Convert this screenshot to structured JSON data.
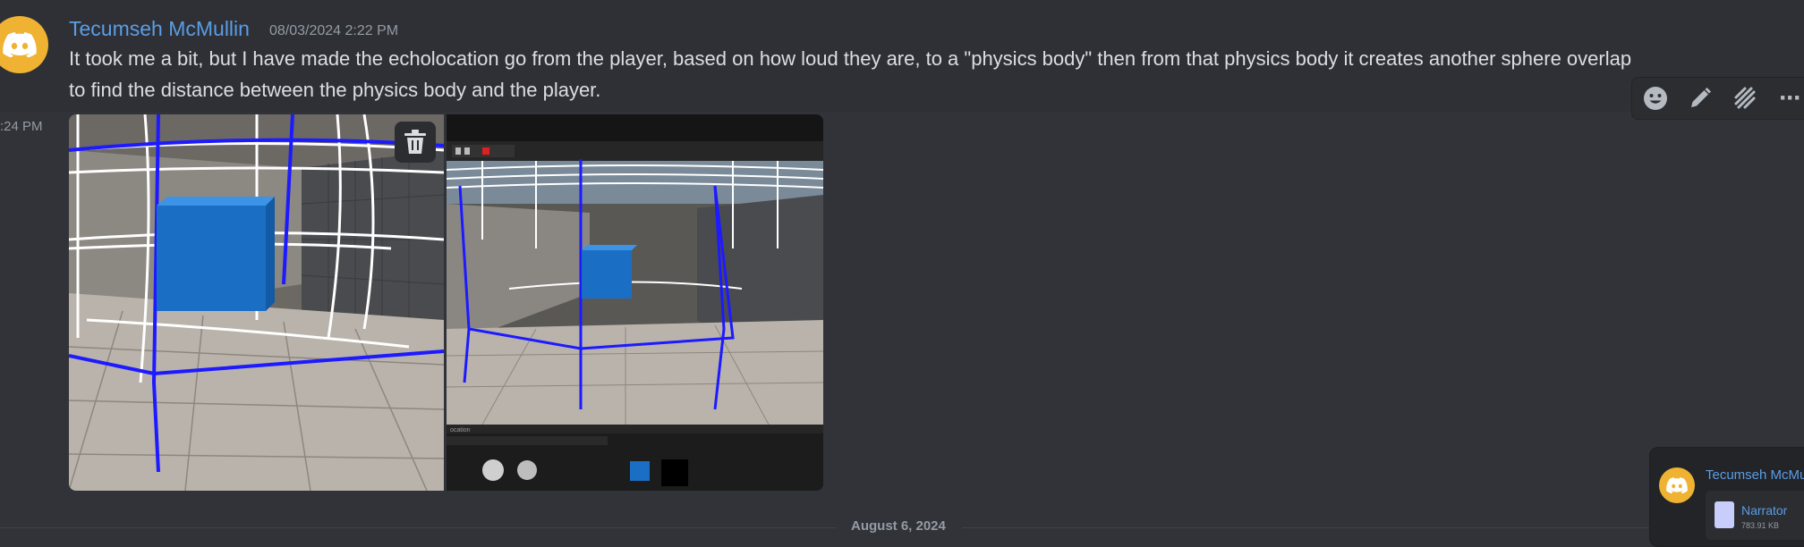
{
  "message": {
    "author": "Tecumseh McMullin",
    "timestamp": "08/03/2024 2:22 PM",
    "content_line1": "It took me a bit, but I have made the echolocation go from the player, based on how loud they are, to a \"physics body\" then from that physics body it creates another sphere overlap",
    "content_line2": "to find the distance between the physics body and the player."
  },
  "next_message": {
    "side_time": ":24 PM"
  },
  "toolbar": {
    "icons": [
      "emoji-icon",
      "pencil-icon",
      "thread-icon",
      "more-icon"
    ],
    "more_label": "···"
  },
  "attachments": {
    "trash_icon": "trash-icon",
    "image2_label": "ocation"
  },
  "divider": {
    "date": "August 6, 2024"
  },
  "popup": {
    "author": "Tecumseh McMullin",
    "file_name": "Narrator",
    "file_size": "783.91 KB"
  },
  "colors": {
    "background": "#313338",
    "author": "#5a9de6",
    "avatar": "#f0b232",
    "muted": "#949ba4"
  }
}
